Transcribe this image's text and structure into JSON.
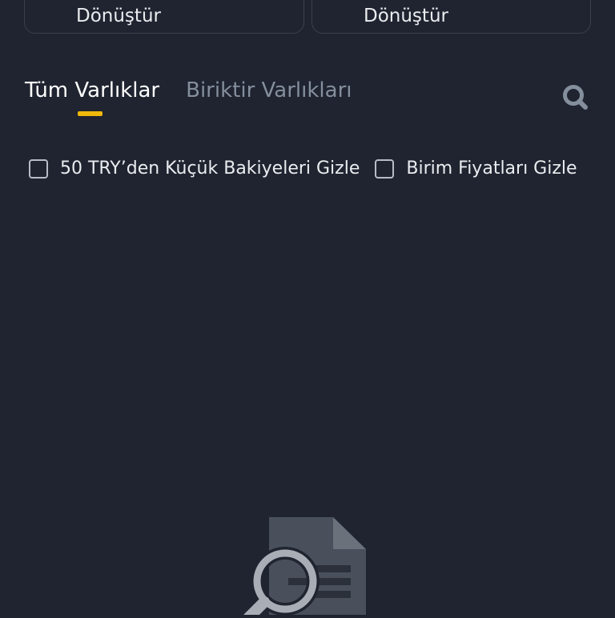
{
  "cards": [
    {
      "label": "Dönüştür",
      "dot_color": "#d9304e"
    },
    {
      "label": "Dönüştür",
      "dot_color": "#f0b90b"
    }
  ],
  "tabs": [
    {
      "label": "Tüm Varlıklar",
      "active": true
    },
    {
      "label": "Biriktir Varlıkları",
      "active": false
    }
  ],
  "filters": {
    "hide_small_balances": {
      "label": "50 TRY’den Küçük Bakiyeleri Gizle",
      "checked": false
    },
    "hide_unit_prices": {
      "label": "Birim Fiyatları Gizle",
      "checked": false
    }
  },
  "colors": {
    "background": "#1f2430",
    "accent": "#f0b90b",
    "inactive_text": "#848e9c",
    "card_border": "#3a414d"
  },
  "icons": {
    "search": "search-icon",
    "empty_state": "document-search-icon"
  }
}
